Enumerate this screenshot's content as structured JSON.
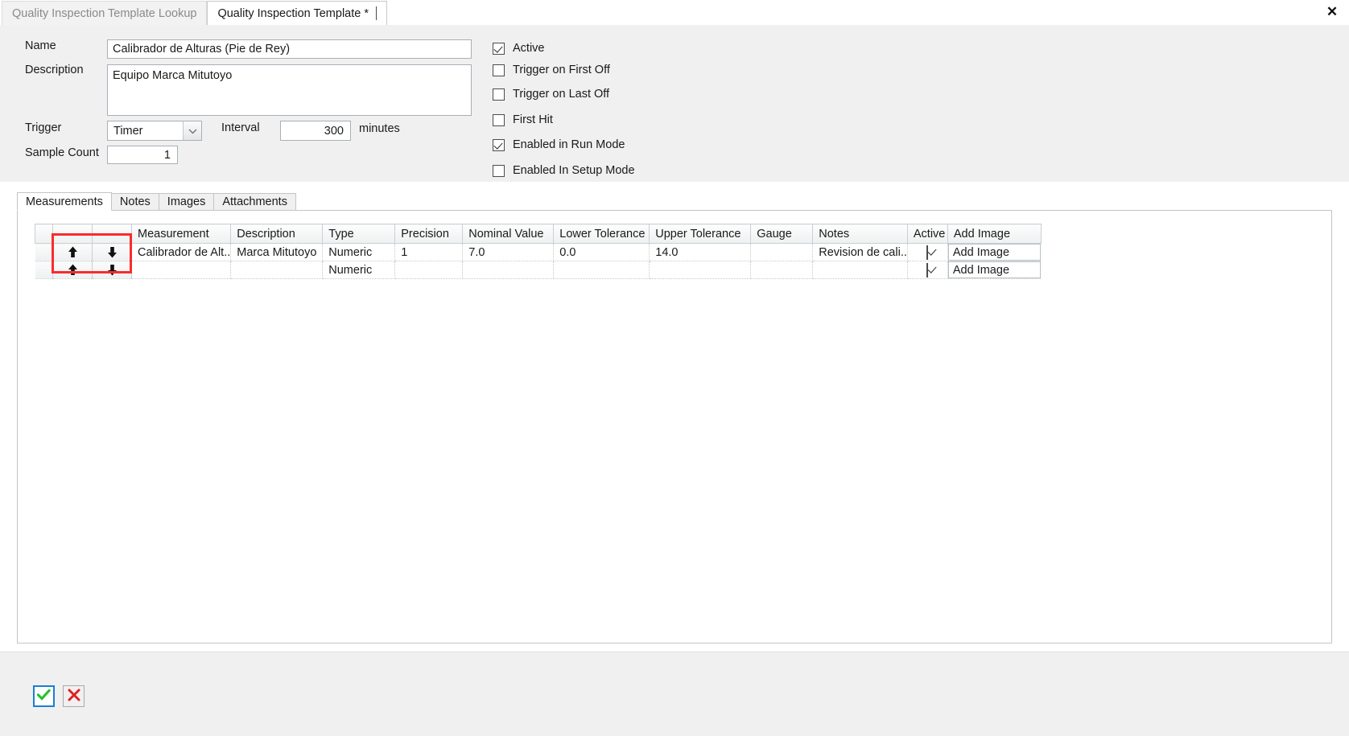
{
  "window": {
    "close_label": "✕"
  },
  "doc_tabs": [
    {
      "label": "Quality Inspection Template Lookup",
      "active": false
    },
    {
      "label": "Quality Inspection Template *",
      "active": true
    }
  ],
  "form": {
    "name_label": "Name",
    "name_value": "Calibrador de Alturas (Pie de Rey)",
    "description_label": "Description",
    "description_value": "Equipo Marca Mitutoyo",
    "trigger_label": "Trigger",
    "trigger_value": "Timer",
    "interval_label": "Interval",
    "interval_value": "300",
    "interval_units": "minutes",
    "sample_count_label": "Sample Count",
    "sample_count_value": "1"
  },
  "options": [
    {
      "label": "Active",
      "checked": true
    },
    {
      "label": "Trigger on First Off",
      "checked": false
    },
    {
      "label": "Trigger on Last Off",
      "checked": false
    },
    {
      "label": "First Hit",
      "checked": false
    },
    {
      "label": "Enabled in Run Mode",
      "checked": true
    },
    {
      "label": "Enabled In Setup Mode",
      "checked": false
    }
  ],
  "inner_tabs": [
    {
      "label": "Measurements",
      "active": true
    },
    {
      "label": "Notes",
      "active": false
    },
    {
      "label": "Images",
      "active": false
    },
    {
      "label": "Attachments",
      "active": false
    }
  ],
  "grid": {
    "columns": [
      "Measurement",
      "Description",
      "Type",
      "Precision",
      "Nominal Value",
      "Lower Tolerance",
      "Upper Tolerance",
      "Gauge",
      "Notes",
      "Active",
      "Add Image"
    ],
    "move_up_icon": "arrow-up-icon",
    "move_down_icon": "arrow-down-icon",
    "rows": [
      {
        "measurement": "Calibrador de Alt..",
        "description": "Marca Mitutoyo",
        "type": "Numeric",
        "precision": "1",
        "nominal_value": "7.0",
        "lower_tolerance": "0.0",
        "upper_tolerance": "14.0",
        "gauge": "",
        "notes": "Revision de cali..",
        "active": true,
        "add_image_label": "Add Image"
      },
      {
        "measurement": "",
        "description": "",
        "type": "Numeric",
        "precision": "",
        "nominal_value": "",
        "lower_tolerance": "",
        "upper_tolerance": "",
        "gauge": "",
        "notes": "",
        "active": true,
        "add_image_label": "Add Image"
      }
    ]
  },
  "footer": {
    "ok_icon": "check-icon",
    "cancel_icon": "cross-icon"
  },
  "colors": {
    "accent": "#1b7fd4",
    "ok": "#22c32a",
    "cancel": "#e02020",
    "highlight": "#fb2c2c"
  }
}
